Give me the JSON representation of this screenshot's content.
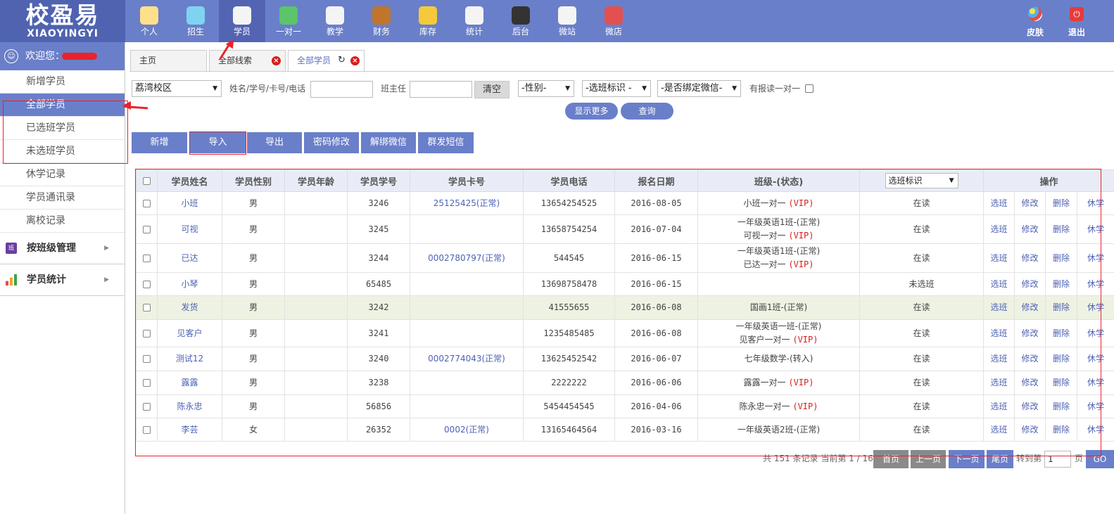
{
  "logo": {
    "main": "校盈易",
    "sub": "XIAOYINGYI"
  },
  "nav": [
    {
      "label": "个人",
      "icon": "person-icon"
    },
    {
      "label": "招生",
      "icon": "magnifier-icon"
    },
    {
      "label": "学员",
      "icon": "student-card-icon"
    },
    {
      "label": "一对一",
      "icon": "chat-bubble-icon"
    },
    {
      "label": "教学",
      "icon": "pencil-notebook-icon"
    },
    {
      "label": "财务",
      "icon": "briefcase-icon"
    },
    {
      "label": "库存",
      "icon": "pie-chart-icon"
    },
    {
      "label": "统计",
      "icon": "bar-chart-icon"
    },
    {
      "label": "后台",
      "icon": "monitor-icon"
    },
    {
      "label": "微站",
      "icon": "web-page-icon"
    },
    {
      "label": "微店",
      "icon": "shop-icon"
    }
  ],
  "nav_right": [
    {
      "label": "皮肤",
      "icon": "palette-icon"
    },
    {
      "label": "退出",
      "icon": "power-icon"
    }
  ],
  "sidebar": {
    "welcome": "欢迎您：",
    "items": [
      "新增学员",
      "全部学员",
      "已选班学员",
      "未选班学员",
      "休学记录",
      "学员通讯录",
      "离校记录"
    ],
    "groups": [
      {
        "label": "按班级管理",
        "icon": "class-icon"
      },
      {
        "label": "学员统计",
        "icon": "bar-chart-icon"
      }
    ]
  },
  "tabs": [
    {
      "label": "主页"
    },
    {
      "label": "全部线索"
    },
    {
      "label": "全部学员"
    }
  ],
  "filters": {
    "campus": "荔湾校区",
    "search_label": "姓名/学号/卡号/电话",
    "teacher_label": "班主任",
    "clear": "清空",
    "gender": "-性别-",
    "class_tag": "-选班标识 -",
    "wechat": "-是否绑定微信-",
    "one_on_one_label": "有报读一对一",
    "show_more": "显示更多",
    "query": "查询"
  },
  "actions": [
    "新增",
    "导入",
    "导出",
    "密码修改",
    "解绑微信",
    "群发短信"
  ],
  "table": {
    "headers": [
      "学员姓名",
      "学员性别",
      "学员年龄",
      "学员学号",
      "学员卡号",
      "学员电话",
      "报名日期",
      "班级-(状态)",
      "选班标识",
      "操作"
    ],
    "ops": [
      "选班",
      "修改",
      "删除",
      "休学"
    ],
    "rows": [
      {
        "name": "小班",
        "gender": "男",
        "age": "",
        "no": "3246",
        "card": "25125425(正常)",
        "phone": "13654254525",
        "date": "2016-08-05",
        "class": [
          {
            "t": "小班一对一",
            "vip": "(VIP)"
          }
        ],
        "tag": "在读"
      },
      {
        "name": "可视",
        "gender": "男",
        "age": "",
        "no": "3245",
        "card": "",
        "phone": "13658754254",
        "date": "2016-07-04",
        "class": [
          {
            "t": "一年级英语1班-(正常)",
            "vip": ""
          },
          {
            "t": "可视一对一",
            "vip": "(VIP)"
          }
        ],
        "tag": "在读"
      },
      {
        "name": "已达",
        "gender": "男",
        "age": "",
        "no": "3244",
        "card": "0002780797(正常)",
        "phone": "544545",
        "date": "2016-06-15",
        "class": [
          {
            "t": "一年级英语1班-(正常)",
            "vip": ""
          },
          {
            "t": "已达一对一",
            "vip": "(VIP)"
          }
        ],
        "tag": "在读"
      },
      {
        "name": "小琴",
        "gender": "男",
        "age": "",
        "no": "65485",
        "card": "",
        "phone": "13698758478",
        "date": "2016-06-15",
        "class": [],
        "tag": "未选班"
      },
      {
        "name": "发货",
        "gender": "男",
        "age": "",
        "no": "3242",
        "card": "",
        "phone": "41555655",
        "date": "2016-06-08",
        "class": [
          {
            "t": "国画1班-(正常)",
            "vip": ""
          }
        ],
        "tag": "在读"
      },
      {
        "name": "见客户",
        "gender": "男",
        "age": "",
        "no": "3241",
        "card": "",
        "phone": "1235485485",
        "date": "2016-06-08",
        "class": [
          {
            "t": "一年级英语一班-(正常)",
            "vip": ""
          },
          {
            "t": "见客户一对一",
            "vip": "(VIP)"
          }
        ],
        "tag": "在读"
      },
      {
        "name": "测试12",
        "gender": "男",
        "age": "",
        "no": "3240",
        "card": "0002774043(正常)",
        "phone": "13625452542",
        "date": "2016-06-07",
        "class": [
          {
            "t": "七年级数学-(转入)",
            "vip": ""
          }
        ],
        "tag": "在读"
      },
      {
        "name": "露露",
        "gender": "男",
        "age": "",
        "no": "3238",
        "card": "",
        "phone": "2222222",
        "date": "2016-06-06",
        "class": [
          {
            "t": "露露一对一",
            "vip": "(VIP)"
          }
        ],
        "tag": "在读"
      },
      {
        "name": "陈永忠",
        "gender": "男",
        "age": "",
        "no": "56856",
        "card": "",
        "phone": "5454454545",
        "date": "2016-04-06",
        "class": [
          {
            "t": "陈永忠一对一",
            "vip": "(VIP)"
          }
        ],
        "tag": "在读"
      },
      {
        "name": "李芸",
        "gender": "女",
        "age": "",
        "no": "26352",
        "card": "0002(正常)",
        "phone": "13165464564",
        "date": "2016-03-16",
        "class": [
          {
            "t": "一年级英语2班-(正常)",
            "vip": ""
          }
        ],
        "tag": "在读"
      }
    ]
  },
  "pager": {
    "info": "共 151 条记录 当前第 1 / 16",
    "first": "首页",
    "prev": "上一页",
    "next": "下一页",
    "last": "尾页",
    "goto_label": "转到第",
    "page_value": "1",
    "page_unit": "页",
    "go": "GO"
  },
  "colors": {
    "accent": "#6a7fc9",
    "annotation": "#e8232b",
    "vip": "#d81e1e"
  }
}
